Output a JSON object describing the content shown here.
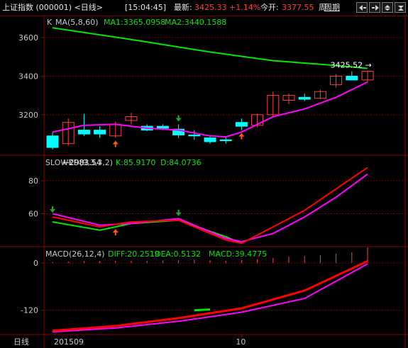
{
  "header": {
    "title": "上证指数 (000001) <日线>",
    "time": "[15:04:45]",
    "latest_label": "最新:",
    "latest_value": "3425.33",
    "change_pct": "+1.14%",
    "open_label": "今开:",
    "open_value": "3377.55",
    "period_cut": "周",
    "period_link": "周期",
    "buttons": [
      "prev-icon",
      "next-icon",
      "zoom-out-icon",
      "zoom-in-icon"
    ]
  },
  "panels": {
    "k": {
      "prefix": "K",
      "ma_label": "MA(5,8,60)",
      "ma1": "MA1:3365.0958",
      "ma2": "MA2:3440.1588",
      "low_annotation": "2983.54",
      "high_annotation": "3425.52",
      "ylim": [
        2990,
        3710
      ],
      "yticks": [
        3200,
        3400,
        3600
      ]
    },
    "kd": {
      "label": "SLOWKD(9,3,3,2)",
      "k": "K:85.9170",
      "d": "D:84.0736",
      "ylim": [
        40,
        95
      ],
      "yticks": [
        60,
        80
      ]
    },
    "macd": {
      "label": "MACD(26,12,4)",
      "diff": "DIFF:20.2519",
      "dea": "DEA:0.5132",
      "macd": "MACD:39.4775",
      "ylim": [
        -180,
        40
      ],
      "yticks": [
        -120,
        0
      ]
    }
  },
  "footer": {
    "period": "日线",
    "date_start": "201509",
    "date_mid": "10"
  },
  "colors": {
    "up": "#ff4040",
    "down": "#00ffff",
    "ma1": "#ff00ff",
    "ma2": "#00e600",
    "kd_k": "#ff0000",
    "kd_d": "#ff00ff",
    "signal_up": "#ff5a00",
    "signal_down": "#22aa22"
  },
  "chart_data": {
    "type": "candlestick",
    "candles": [
      {
        "o": 3090,
        "h": 3110,
        "l": 3020,
        "c": 3030
      },
      {
        "o": 3050,
        "h": 3180,
        "l": 3040,
        "c": 3160
      },
      {
        "o": 3120,
        "h": 3205,
        "l": 3090,
        "c": 3100
      },
      {
        "o": 3120,
        "h": 3140,
        "l": 3080,
        "c": 3100
      },
      {
        "o": 3090,
        "h": 3165,
        "l": 3080,
        "c": 3150
      },
      {
        "o": 3170,
        "h": 3210,
        "l": 3150,
        "c": 3190
      },
      {
        "o": 3140,
        "h": 3150,
        "l": 3115,
        "c": 3120
      },
      {
        "o": 3140,
        "h": 3150,
        "l": 3120,
        "c": 3130
      },
      {
        "o": 3125,
        "h": 3150,
        "l": 3080,
        "c": 3095
      },
      {
        "o": 3095,
        "h": 3120,
        "l": 3070,
        "c": 3090
      },
      {
        "o": 3080,
        "h": 3090,
        "l": 3050,
        "c": 3060
      },
      {
        "o": 3070,
        "h": 3085,
        "l": 3050,
        "c": 3065
      },
      {
        "o": 3160,
        "h": 3180,
        "l": 3120,
        "c": 3140
      },
      {
        "o": 3145,
        "h": 3205,
        "l": 3135,
        "c": 3200
      },
      {
        "o": 3200,
        "h": 3320,
        "l": 3190,
        "c": 3300
      },
      {
        "o": 3275,
        "h": 3310,
        "l": 3255,
        "c": 3300
      },
      {
        "o": 3290,
        "h": 3310,
        "l": 3270,
        "c": 3280
      },
      {
        "o": 3285,
        "h": 3330,
        "l": 3280,
        "c": 3320
      },
      {
        "o": 3355,
        "h": 3410,
        "l": 3340,
        "c": 3400
      },
      {
        "o": 3400,
        "h": 3425,
        "l": 3390,
        "c": 3380
      },
      {
        "o": 3380,
        "h": 3430,
        "l": 3370,
        "c": 3425
      }
    ],
    "ma1": [
      [
        0,
        3110
      ],
      [
        2,
        3145
      ],
      [
        4,
        3150
      ],
      [
        6,
        3130
      ],
      [
        8,
        3120
      ],
      [
        10,
        3090
      ],
      [
        11,
        3085
      ],
      [
        12,
        3110
      ],
      [
        14,
        3190
      ],
      [
        16,
        3230
      ],
      [
        18,
        3290
      ],
      [
        20,
        3370
      ]
    ],
    "ma2": [
      [
        0,
        3650
      ],
      [
        5,
        3590
      ],
      [
        10,
        3525
      ],
      [
        14,
        3480
      ],
      [
        18,
        3455
      ],
      [
        20,
        3440
      ]
    ],
    "signals": [
      {
        "i": 4,
        "type": "up"
      },
      {
        "i": 8,
        "type": "down"
      },
      {
        "i": 12,
        "type": "up"
      }
    ],
    "kd_k": [
      [
        0,
        58
      ],
      [
        3,
        52
      ],
      [
        5,
        55
      ],
      [
        8,
        56
      ],
      [
        11,
        44
      ],
      [
        12,
        42
      ],
      [
        14,
        52
      ],
      [
        16,
        62
      ],
      [
        18,
        75
      ],
      [
        20,
        88
      ]
    ],
    "kd_d": [
      [
        0,
        60
      ],
      [
        3,
        53
      ],
      [
        5,
        54
      ],
      [
        8,
        57
      ],
      [
        11,
        45
      ],
      [
        12,
        43
      ],
      [
        14,
        48
      ],
      [
        16,
        58
      ],
      [
        18,
        70
      ],
      [
        20,
        84
      ]
    ],
    "kd_green": [
      [
        0,
        55
      ],
      [
        3,
        50
      ],
      [
        5,
        54
      ],
      [
        8,
        56
      ],
      [
        11,
        46
      ],
      [
        12,
        42
      ]
    ],
    "kd_signals": [
      {
        "i": 0,
        "type": "down"
      },
      {
        "i": 4,
        "type": "up"
      },
      {
        "i": 8,
        "type": "down"
      }
    ],
    "macd_diff": [
      [
        0,
        -172
      ],
      [
        4,
        -160
      ],
      [
        8,
        -140
      ],
      [
        12,
        -115
      ],
      [
        16,
        -70
      ],
      [
        20,
        5
      ]
    ],
    "macd_dea": [
      [
        0,
        -175
      ],
      [
        4,
        -165
      ],
      [
        8,
        -148
      ],
      [
        12,
        -125
      ],
      [
        16,
        -90
      ],
      [
        20,
        -2
      ]
    ],
    "macd_green_segment": [
      [
        9,
        -120
      ],
      [
        10,
        -118
      ]
    ],
    "macd_hist": [
      {
        "i": 0,
        "v": 3
      },
      {
        "i": 1,
        "v": 4
      },
      {
        "i": 2,
        "v": 5
      },
      {
        "i": 3,
        "v": 5
      },
      {
        "i": 4,
        "v": 6
      },
      {
        "i": 5,
        "v": 6
      },
      {
        "i": 6,
        "v": 6
      },
      {
        "i": 7,
        "v": 7
      },
      {
        "i": 8,
        "v": 7
      },
      {
        "i": 9,
        "v": 8
      },
      {
        "i": 10,
        "v": 7
      },
      {
        "i": 11,
        "v": 6
      },
      {
        "i": 12,
        "v": 8
      },
      {
        "i": 13,
        "v": 10
      },
      {
        "i": 14,
        "v": 13
      },
      {
        "i": 15,
        "v": 16
      },
      {
        "i": 16,
        "v": 18
      },
      {
        "i": 17,
        "v": 20
      },
      {
        "i": 18,
        "v": 24
      },
      {
        "i": 19,
        "v": 28
      },
      {
        "i": 20,
        "v": 40
      }
    ]
  }
}
